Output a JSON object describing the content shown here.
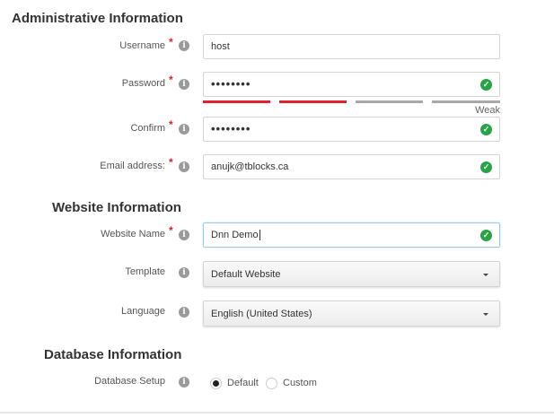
{
  "sections": {
    "admin": "Administrative Information",
    "website": "Website Information",
    "database": "Database Information"
  },
  "fields": {
    "username": {
      "label": "Username",
      "value": "host"
    },
    "password": {
      "label": "Password",
      "value": "••••••••",
      "strength": "Weak",
      "strength_level": 0.5
    },
    "confirm": {
      "label": "Confirm",
      "value": "••••••••"
    },
    "email": {
      "label": "Email address:",
      "value": "anujk@tblocks.ca"
    },
    "website_name": {
      "label": "Website Name",
      "value": "Dnn Demo"
    },
    "template": {
      "label": "Template",
      "value": "Default Website"
    },
    "language": {
      "label": "Language",
      "value": "English (United States)"
    },
    "database_setup": {
      "label": "Database Setup",
      "options": [
        "Default",
        "Custom"
      ],
      "selected": "Default"
    }
  },
  "required_mark": "*",
  "info_glyph": "i",
  "check_glyph": "✓",
  "colors": {
    "required": "#d9232e",
    "valid": "#27a348",
    "strength_on": "#e0212e",
    "strength_off": "#a8a8a8"
  }
}
